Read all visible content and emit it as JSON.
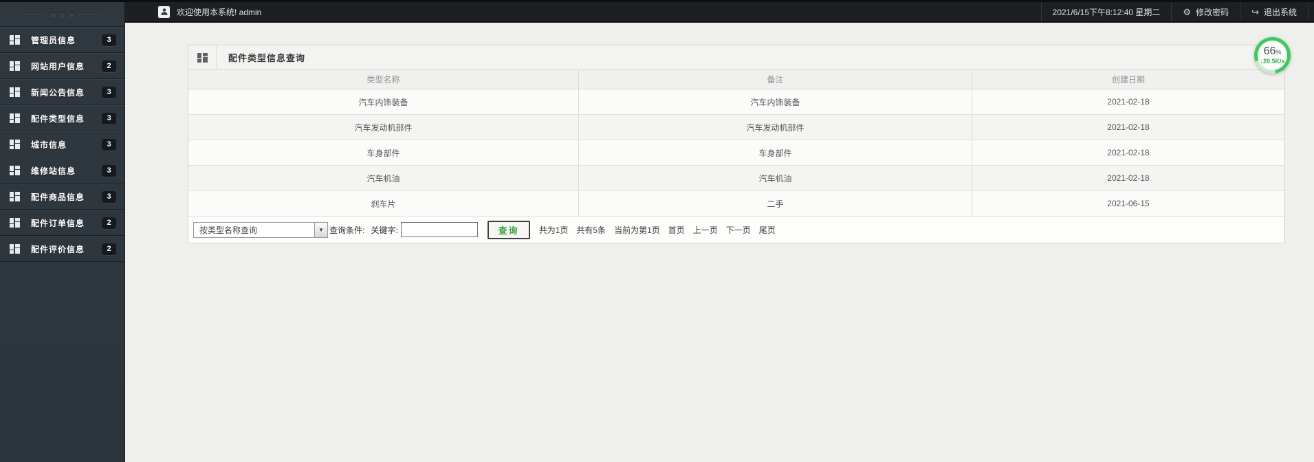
{
  "topbar": {
    "welcome": "欢迎使用本系统! admin",
    "datetime": "2021/6/15下午8:12:40 星期二",
    "change_password": "修改密码",
    "logout": "退出系统",
    "gear_glyph": "⚙",
    "logout_glyph": "↪"
  },
  "sidebar": {
    "items": [
      {
        "label": "管理员信息",
        "badge": "3"
      },
      {
        "label": "网站用户信息",
        "badge": "2"
      },
      {
        "label": "新闻公告信息",
        "badge": "3"
      },
      {
        "label": "配件类型信息",
        "badge": "3"
      },
      {
        "label": "城市信息",
        "badge": "3"
      },
      {
        "label": "维修站信息",
        "badge": "3"
      },
      {
        "label": "配件商品信息",
        "badge": "3"
      },
      {
        "label": "配件订单信息",
        "badge": "2"
      },
      {
        "label": "配件评价信息",
        "badge": "2"
      }
    ]
  },
  "panel": {
    "title": "配件类型信息查询"
  },
  "table": {
    "columns": [
      "类型名称",
      "备注",
      "创建日期"
    ],
    "rows": [
      {
        "type": "汽车内饰装备",
        "note": "汽车内饰装备",
        "date": "2021-02-18"
      },
      {
        "type": "汽车发动机部件",
        "note": "汽车发动机部件",
        "date": "2021-02-18"
      },
      {
        "type": "车身部件",
        "note": "车身部件",
        "date": "2021-02-18"
      },
      {
        "type": "汽车机油",
        "note": "汽车机油",
        "date": "2021-02-18"
      },
      {
        "type": "刹车片",
        "note": "二手",
        "date": "2021-06-15"
      }
    ]
  },
  "query": {
    "dropdown_value": "按类型名称查询",
    "dropdown_arrow": "▼",
    "condition_label": "查询条件:",
    "keyword_label": "关键字:",
    "input_value": "",
    "search_button": "查询",
    "pagination": {
      "total_pages": "共为1页",
      "total_records": "共有5条",
      "current_page": "当前为第1页",
      "first": "首页",
      "prev": "上一页",
      "next": "下一页",
      "last": "尾页"
    }
  },
  "speed_badge": {
    "percent": "66",
    "percent_sign": "%",
    "speed": "↓20.5K/s"
  },
  "colors": {
    "accent_green": "#3aa43a",
    "badge_ring_green": "#3ec95e",
    "sidebar_bg": "#2e363e",
    "topbar_bg": "#1c2023",
    "badge_bg": "#151a1e"
  }
}
